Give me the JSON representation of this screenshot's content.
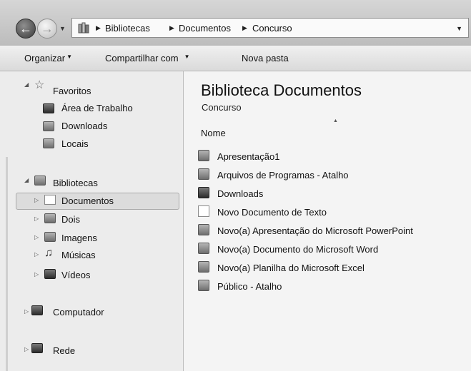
{
  "address": {
    "crumbs": [
      "Bibliotecas",
      "Documentos",
      "Concurso"
    ]
  },
  "toolbar": {
    "organize_label": "Organizar",
    "share_label": "Compartilhar com",
    "new_folder_label": "Nova pasta"
  },
  "nav": {
    "favorites": "Favoritos",
    "fav_items": [
      "Área de Trabalho",
      "Downloads",
      "Locais"
    ],
    "libraries": "Bibliotecas",
    "lib_items": [
      "Documentos",
      "Dois",
      "Imagens",
      "Músicas",
      "Vídeos"
    ],
    "computer": "Computador",
    "network": "Rede",
    "selected": "Documentos"
  },
  "content": {
    "title": "Biblioteca  Documentos",
    "subtitle": "Concurso",
    "column_name": "Nome",
    "files": [
      "Apresentação1",
      "Arquivos de Programas - Atalho",
      "Downloads",
      "Novo Documento de Texto",
      "Novo(a) Apresentação do Microsoft PowerPoint",
      "Novo(a) Documento do Microsoft Word",
      "Novo(a) Planilha do Microsoft Excel",
      "Público - Atalho"
    ]
  }
}
